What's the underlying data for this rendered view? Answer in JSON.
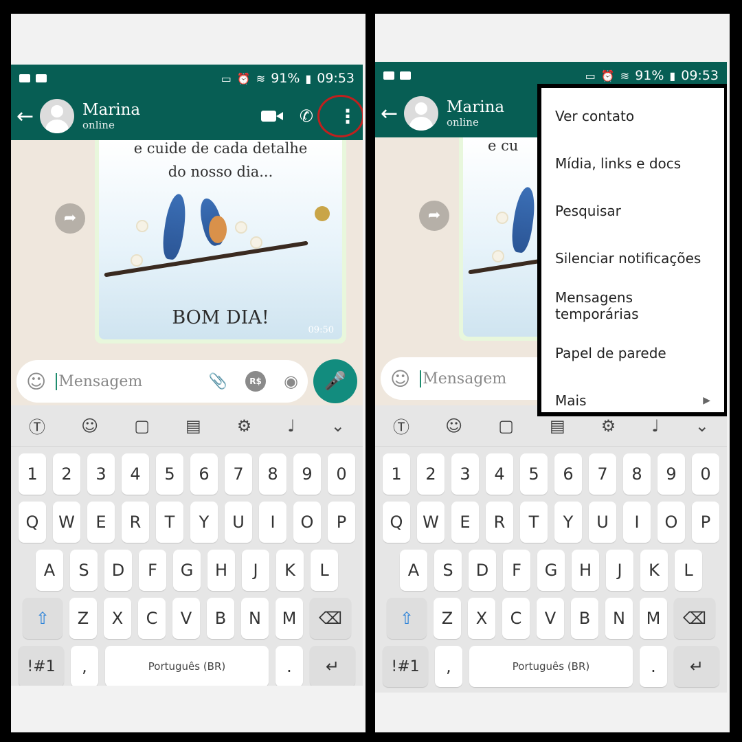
{
  "status": {
    "percent": "91%",
    "time_left": "09:53",
    "time_right": "09:53"
  },
  "contact": {
    "name": "Marina",
    "status": "online"
  },
  "message": {
    "line1": "e cuide de cada detalhe",
    "line2": "do nosso dia...",
    "bottom": "BOM DIA!",
    "time": "09:50",
    "right_fragment": "e cu"
  },
  "input": {
    "placeholder": "Mensagem"
  },
  "menu": {
    "items": [
      "Ver contato",
      "Mídia, links e docs",
      "Pesquisar",
      "Silenciar notificações",
      "Mensagens temporárias",
      "Papel de parede",
      "Mais"
    ]
  },
  "keyboard": {
    "numbers": [
      "1",
      "2",
      "3",
      "4",
      "5",
      "6",
      "7",
      "8",
      "9",
      "0"
    ],
    "row1": [
      "Q",
      "W",
      "E",
      "R",
      "T",
      "Y",
      "U",
      "I",
      "O",
      "P"
    ],
    "row2": [
      "A",
      "S",
      "D",
      "F",
      "G",
      "H",
      "J",
      "K",
      "L"
    ],
    "row3": [
      "Z",
      "X",
      "C",
      "V",
      "B",
      "N",
      "M"
    ],
    "sym": "!#1",
    "comma": ",",
    "space": "Português (BR)",
    "period": "."
  },
  "icons": {
    "back": "arrow-left",
    "video": "video-camera",
    "call": "phone",
    "more": "vertical-dots",
    "emoji": "smiley",
    "attach": "paperclip",
    "money": "currency",
    "camera": "camera",
    "mic": "microphone"
  },
  "colors": {
    "header": "#075e54",
    "accent": "#128c7e",
    "highlight_circle": "#c0201e"
  }
}
